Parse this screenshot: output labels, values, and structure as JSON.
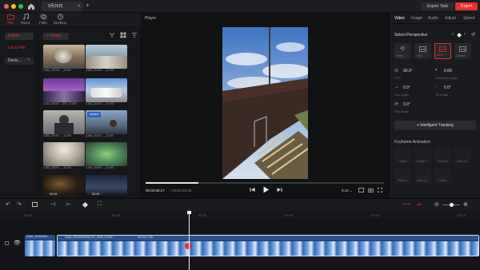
{
  "titlebar": {
    "tab_label": "9月26日",
    "export_task_label": "Export Task",
    "export_label": "Export"
  },
  "media_tabs": [
    {
      "label": "File",
      "icon": "folder-icon",
      "active": true
    },
    {
      "label": "Music",
      "icon": "music-icon",
      "active": false
    },
    {
      "label": "Filter",
      "icon": "filter-icon",
      "active": false
    },
    {
      "label": "Desktop",
      "icon": "clock-icon",
      "active": false
    }
  ],
  "sidebar": {
    "import_label": "Import",
    "local_file_label": "Local File",
    "device_label": "Devic..."
  },
  "media": {
    "import_label": "+ Import",
    "thumbs": [
      {
        "caption": "CAM_20200…_D.000",
        "style": "building"
      },
      {
        "caption": "CAM_20200…_D.000",
        "style": "rooftop"
      },
      {
        "caption": "CAM_20200…D02_D.000",
        "style": "purple"
      },
      {
        "caption": "CAM_20200…_D.000",
        "style": "city"
      },
      {
        "caption": "CAM_20200…_D.000",
        "style": "person"
      },
      {
        "caption": "CAM_20200…_D.000",
        "style": "person2"
      },
      {
        "caption": "CAM_20200…_D.000",
        "style": "dome"
      },
      {
        "caption": "CAM_20200…_D.000",
        "style": "dome2"
      },
      {
        "caption": "",
        "duration": "00:46",
        "style": "night"
      },
      {
        "caption": "",
        "duration": "02:40",
        "style": "night2"
      }
    ],
    "added_badge": "Added"
  },
  "player": {
    "title": "Player",
    "current_time": "00:00:56:27",
    "total_time": "/ 00:04:20:00",
    "speed_label": "9:16",
    "progress": 0.22
  },
  "right_panel": {
    "tabs": [
      "Video",
      "Image",
      "Audio",
      "Adjust",
      "Speed"
    ],
    "active_tab": "Video",
    "section_title": "Select Perspective",
    "perspectives": [
      {
        "label": "Inters...",
        "icon": "rotate-icon"
      },
      {
        "label": "Obje...",
        "icon": "camera-icon"
      },
      {
        "label": "Wide...",
        "icon": "camera-icon",
        "selected": true
      },
      {
        "label": "Dramat...",
        "icon": "camera-icon"
      }
    ],
    "fov_value": "90.0°",
    "fov_label": "FOV",
    "distortion_value": "0.00",
    "distortion_label": "Distortion angle",
    "pan_value": "0.0°",
    "pan_label": "Pan angle",
    "tilt_value": "0.0°",
    "tilt_label": "Tilt angle",
    "roll_value": "0.0°",
    "roll_label": "Roll angle",
    "intelligent_tracking_label": "Intelligent Tracking",
    "keyframe_title": "Keyframe Animation",
    "keyframes": [
      "Shake",
      "Linear a...",
      "Push In",
      "Slow m...",
      "Pace ti...",
      "Slow m...",
      "Linear",
      ""
    ]
  },
  "timeline": {
    "ruler": [
      "00:00",
      "00:15",
      "00:30",
      "00:45",
      "01:00",
      "01:15"
    ],
    "clip1_label": "CAM_20200926…",
    "clip2_label": "CAM_20200926154737_0025_D.000",
    "clip2_duration": "00:04:17:26",
    "playhead_fraction": 0.394
  },
  "colors": {
    "accent_red": "#e8322f",
    "clip_blue": "#3c78c8"
  }
}
